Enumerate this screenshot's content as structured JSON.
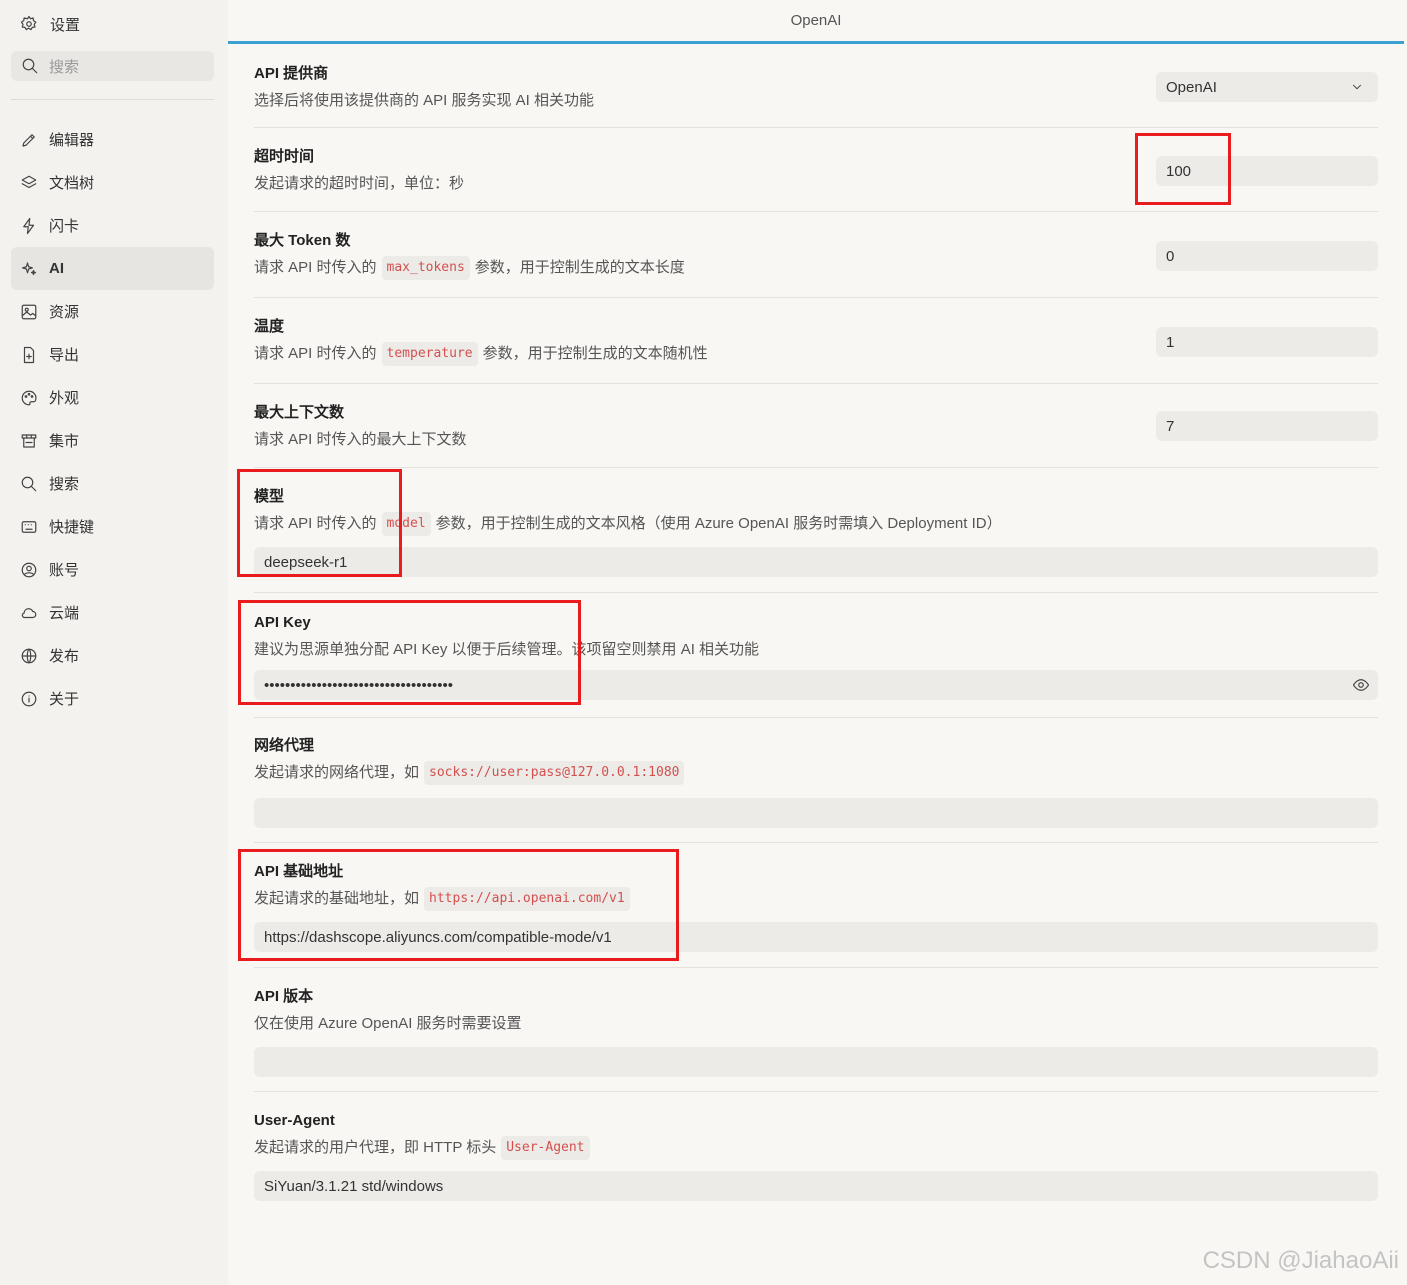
{
  "sidebar": {
    "title": "设置",
    "search_placeholder": "搜索",
    "items": [
      {
        "label": "编辑器",
        "icon": "pen-icon"
      },
      {
        "label": "文档树",
        "icon": "layers-icon"
      },
      {
        "label": "闪卡",
        "icon": "lightning-icon"
      },
      {
        "label": "AI",
        "icon": "sparkle-icon",
        "active": true
      },
      {
        "label": "资源",
        "icon": "image-icon"
      },
      {
        "label": "导出",
        "icon": "export-file-icon"
      },
      {
        "label": "外观",
        "icon": "palette-icon"
      },
      {
        "label": "集市",
        "icon": "store-icon"
      },
      {
        "label": "搜索",
        "icon": "search-icon"
      },
      {
        "label": "快捷键",
        "icon": "keyboard-icon"
      },
      {
        "label": "账号",
        "icon": "account-icon"
      },
      {
        "label": "云端",
        "icon": "cloud-icon"
      },
      {
        "label": "发布",
        "icon": "globe-icon"
      },
      {
        "label": "关于",
        "icon": "info-icon"
      }
    ]
  },
  "tab": {
    "title": "OpenAI"
  },
  "settings": {
    "provider": {
      "label": "API 提供商",
      "desc": "选择后将使用该提供商的 API 服务实现 AI 相关功能",
      "value": "OpenAI"
    },
    "timeout": {
      "label": "超时时间",
      "desc": "发起请求的超时时间，单位：秒",
      "value": "100"
    },
    "max_tokens": {
      "label": "最大 Token 数",
      "desc_pre": "请求 API 时传入的",
      "code": "max_tokens",
      "desc_post": "参数，用于控制生成的文本长度",
      "value": "0"
    },
    "temperature": {
      "label": "温度",
      "desc_pre": "请求 API 时传入的",
      "code": "temperature",
      "desc_post": "参数，用于控制生成的文本随机性",
      "value": "1"
    },
    "max_context": {
      "label": "最大上下文数",
      "desc": "请求 API 时传入的最大上下文数",
      "value": "7"
    },
    "model": {
      "label": "模型",
      "desc_pre": "请求 API 时传入的",
      "code": "model",
      "desc_post": "参数，用于控制生成的文本风格（使用 Azure OpenAI 服务时需填入 Deployment ID）",
      "value": "deepseek-r1"
    },
    "api_key": {
      "label": "API Key",
      "desc": "建议为思源单独分配 API Key 以便于后续管理。该项留空则禁用 AI 相关功能",
      "value": "••••••••••••••••••••••••••••••••••••"
    },
    "proxy": {
      "label": "网络代理",
      "desc_pre": "发起请求的网络代理，如",
      "code": "socks://user:pass@127.0.0.1:1080",
      "value": ""
    },
    "base_url": {
      "label": "API 基础地址",
      "desc_pre": "发起请求的基础地址，如",
      "code": "https://api.openai.com/v1",
      "value": "https://dashscope.aliyuncs.com/compatible-mode/v1"
    },
    "api_version": {
      "label": "API 版本",
      "desc": "仅在使用 Azure OpenAI 服务时需要设置",
      "value": ""
    },
    "user_agent": {
      "label": "User-Agent",
      "desc_pre": "发起请求的用户代理，即 HTTP 标头",
      "code": "User-Agent",
      "value": "SiYuan/3.1.21 std/windows"
    }
  },
  "watermark": "CSDN @JiahaoAii",
  "colors": {
    "accent": "#3ba1d0",
    "highlight_box": "#e81c1c",
    "code_text": "#d4504f"
  }
}
